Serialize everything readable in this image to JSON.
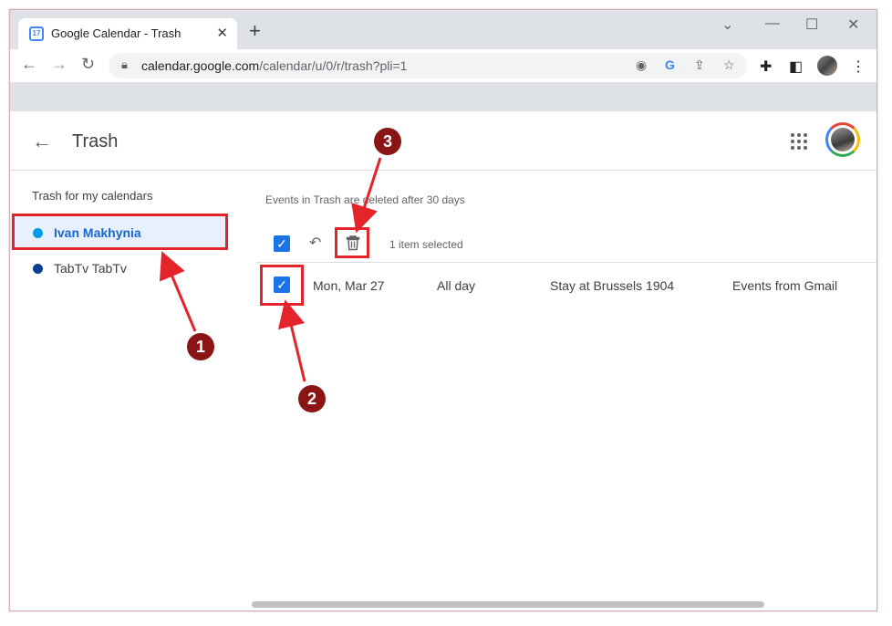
{
  "browser": {
    "tab_title": "Google Calendar - Trash",
    "favicon_text": "17",
    "url_host": "calendar.google.com",
    "url_path": "/calendar/u/0/r/trash?pli=1"
  },
  "header": {
    "title": "Trash"
  },
  "sidebar": {
    "heading": "Trash for my calendars",
    "items": [
      {
        "label": "Ivan Makhynia",
        "color": "#039be5",
        "active": true
      },
      {
        "label": "TabTv TabTv",
        "color": "#0b3d91",
        "active": false
      }
    ]
  },
  "main": {
    "notice": "Events in Trash are deleted after 30 days",
    "selection_text": "1 item selected",
    "rows": [
      {
        "date": "Mon, Mar 27",
        "time": "All day",
        "title": "Stay at Brussels 1904",
        "source": "Events from Gmail",
        "checked": true
      }
    ]
  },
  "annotations": {
    "badges": [
      "1",
      "2",
      "3"
    ],
    "color": "#e3242b"
  },
  "colors": {
    "accent": "#1a73e8",
    "chrome_frame": "#dee1e6"
  }
}
